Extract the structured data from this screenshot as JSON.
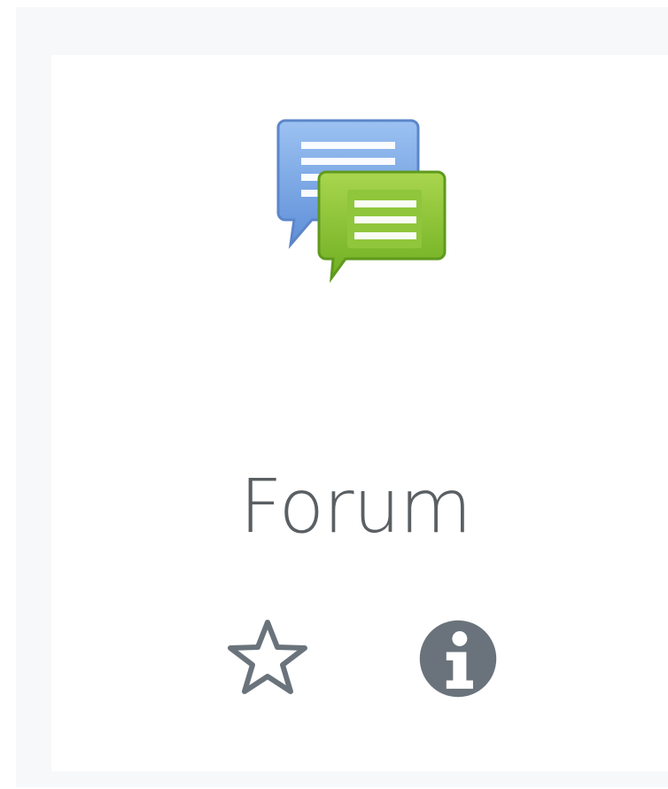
{
  "module": {
    "name": "Forum",
    "icon": "forum-icon"
  },
  "actions": {
    "star_icon": "star-outline-icon",
    "info_icon": "info-icon"
  },
  "colors": {
    "text": "#5a5f63",
    "blue_bubble": "#7aa6e6",
    "green_bubble": "#8cc63f",
    "icon_gray": "#6a737b",
    "panel_bg": "#f7f8f9"
  }
}
